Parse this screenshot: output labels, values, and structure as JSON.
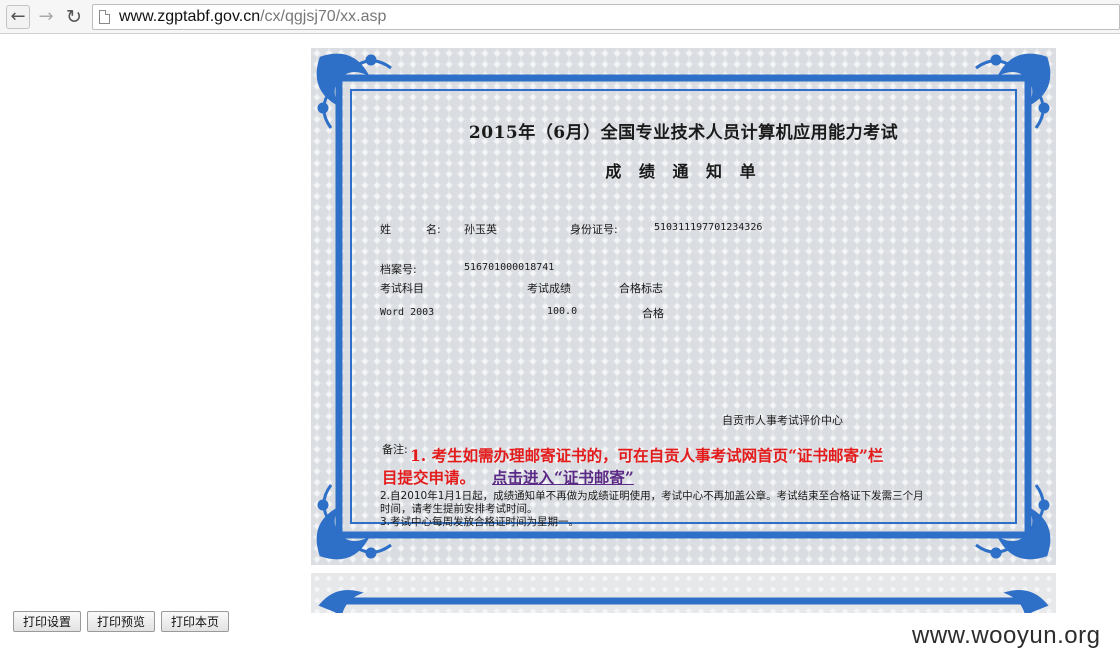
{
  "browser": {
    "url_host": "www.zgptabf.gov.cn",
    "url_path": "/cx/qgjsj70/xx.asp"
  },
  "certificate": {
    "title": "2015年（6月）全国专业技术人员计算机应用能力考试",
    "subtitle": "成 绩 通 知 单",
    "name_label": "姓          名:",
    "name_value": "孙玉英",
    "id_label": "身份证号:",
    "id_value": "510311197701234326",
    "file_label": "档案号:",
    "file_value": "516701000018741",
    "col_subject": "考试科目",
    "col_score": "考试成绩",
    "col_pass": "合格标志",
    "row_subject": "Word 2003",
    "row_score": "100.0",
    "row_pass": "合格",
    "issuer": "自贡市人事考试评价中心",
    "note_label": "备注:",
    "note1_line1": "1. 考生如需办理邮寄证书的，可在自贡人事考试网首页“证书邮寄”栏",
    "note1_line2": "目提交申请。",
    "note1_link": "点击进入“证书邮寄”",
    "note2_line1": "2.自2010年1月1日起，成绩通知单不再做为成绩证明使用，考试中心不再加盖公章。考试结束至合格证下发需三个月",
    "note2_line2": "时间，请考生提前安排考试时间。",
    "note3": "3.考试中心每周发放合格证时间为星期一。"
  },
  "buttons": {
    "print_setup": "打印设置",
    "print_preview": "打印预览",
    "print_page": "打印本页"
  },
  "watermark": "www.wooyun.org",
  "colors": {
    "frame_blue": "#2e6fc7",
    "note_red": "#e41b1b",
    "link_purple": "#5b2a86"
  }
}
